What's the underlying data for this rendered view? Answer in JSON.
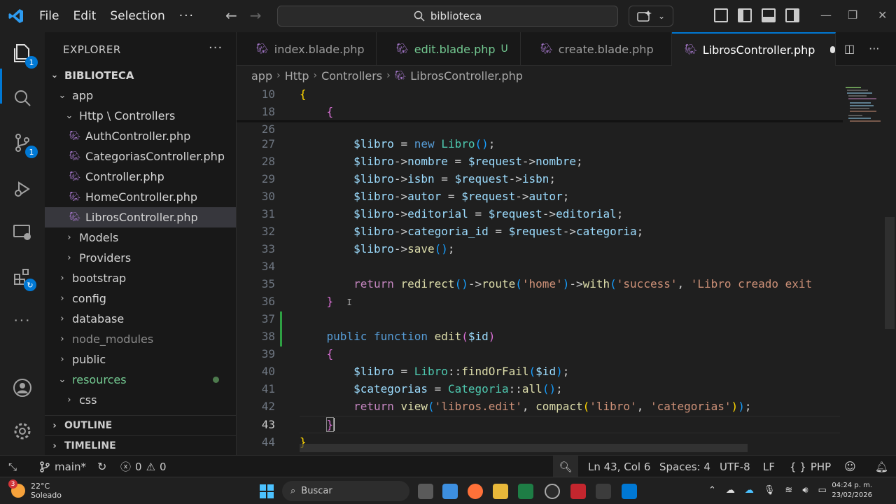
{
  "titlebar": {
    "menu": [
      "File",
      "Edit",
      "Selection"
    ],
    "more": "···",
    "search": "biblioteca"
  },
  "activity": {
    "explorer_badge": "1",
    "scm_badge": "1"
  },
  "explorer": {
    "title": "EXPLORER",
    "more": "···",
    "root": "BIBLIOTECA",
    "items": [
      {
        "label": "app",
        "indent": 1,
        "chevron": "open"
      },
      {
        "label": "Http \\ Controllers",
        "indent": 2,
        "chevron": "open"
      },
      {
        "label": "AuthController.php",
        "indent": 3,
        "chevron": "none"
      },
      {
        "label": "CategoriasController.php",
        "indent": 3,
        "chevron": "none"
      },
      {
        "label": "Controller.php",
        "indent": 3,
        "chevron": "none"
      },
      {
        "label": "HomeController.php",
        "indent": 3,
        "chevron": "none"
      },
      {
        "label": "LibrosController.php",
        "indent": 3,
        "chevron": "none"
      },
      {
        "label": "Models",
        "indent": 2,
        "chevron": "closed"
      },
      {
        "label": "Providers",
        "indent": 2,
        "chevron": "closed"
      },
      {
        "label": "bootstrap",
        "indent": 1,
        "chevron": "closed"
      },
      {
        "label": "config",
        "indent": 1,
        "chevron": "closed"
      },
      {
        "label": "database",
        "indent": 1,
        "chevron": "closed"
      },
      {
        "label": "node_modules",
        "indent": 1,
        "chevron": "closed"
      },
      {
        "label": "public",
        "indent": 1,
        "chevron": "closed"
      },
      {
        "label": "resources",
        "indent": 1,
        "chevron": "open"
      },
      {
        "label": "css",
        "indent": 2,
        "chevron": "closed"
      }
    ],
    "outline": "OUTLINE",
    "timeline": "TIMELINE"
  },
  "tabs": [
    {
      "label": "index.blade.php",
      "status": ""
    },
    {
      "label": "edit.blade.php",
      "status": "U"
    },
    {
      "label": "create.blade.php",
      "status": ""
    },
    {
      "label": "LibrosController.php",
      "status": ""
    }
  ],
  "breadcrumb": [
    "app",
    "Http",
    "Controllers",
    "LibrosController.php"
  ],
  "editor": {
    "line_numbers": [
      "10",
      "18",
      "26",
      "27",
      "28",
      "29",
      "30",
      "31",
      "32",
      "33",
      "34",
      "35",
      "36",
      "37",
      "38",
      "39",
      "40",
      "41",
      "42",
      "43",
      "44"
    ]
  },
  "statusbar": {
    "branch": "main*",
    "errors": "0",
    "warnings": "0",
    "position": "Ln 43, Col 6",
    "spaces": "Spaces: 4",
    "encoding": "UTF-8",
    "eol": "LF",
    "language": "PHP",
    "lang_braces": "{ }"
  },
  "taskbar": {
    "temp": "22°C",
    "weather": "Soleado",
    "weather_badge": "3",
    "search": "Buscar",
    "time": "04:24 p. m.",
    "date": "23/02/2026"
  },
  "colors": {
    "accent": "#0078d4",
    "git_added": "#73c991"
  }
}
